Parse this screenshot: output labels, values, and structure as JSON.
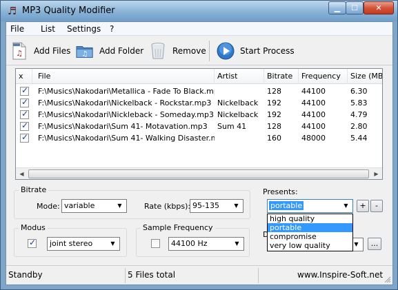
{
  "window": {
    "title": "MP3 Quality Modifier"
  },
  "menu": [
    "File",
    "List",
    "Settings",
    "?"
  ],
  "toolbar": {
    "add_files": "Add Files",
    "add_folder": "Add Folder",
    "remove": "Remove",
    "start_process": "Start Process"
  },
  "table": {
    "columns": [
      "x",
      "File",
      "Artist",
      "Bitrate",
      "Frequency",
      "Size (MB)"
    ],
    "rows": [
      {
        "checked": true,
        "file": "F:\\Musics\\Nakodari\\Metallica - Fade To Black.mp3",
        "artist": "",
        "bitrate": "128",
        "frequency": "44100",
        "size": "6.30"
      },
      {
        "checked": true,
        "file": "F:\\Musics\\Nakodari\\Nickelback - Rockstar.mp3",
        "artist": "Nickelback",
        "bitrate": "192",
        "frequency": "44100",
        "size": "5.83"
      },
      {
        "checked": true,
        "file": "F:\\Musics\\Nakodari\\Nickleback - Someday.mp3",
        "artist": "Nickelback",
        "bitrate": "192",
        "frequency": "44100",
        "size": "4.79"
      },
      {
        "checked": true,
        "file": "F:\\Musics\\Nakodari\\Sum 41- Motavation.mp3",
        "artist": "Sum 41",
        "bitrate": "128",
        "frequency": "44100",
        "size": "2.80"
      },
      {
        "checked": true,
        "file": "F:\\Musics\\Nakodari\\Sum 41- Walking Disaster.mp3",
        "artist": "",
        "bitrate": "160",
        "frequency": "48000",
        "size": "5.44"
      }
    ]
  },
  "bitrate": {
    "group_label": "Bitrate",
    "mode_label": "Mode:",
    "mode_value": "variable",
    "rate_label": "Rate (kbps):",
    "rate_value": "95-135"
  },
  "modus": {
    "group_label": "Modus",
    "checked": true,
    "value": "joint stereo"
  },
  "sample_frequency": {
    "group_label": "Sample Frequency",
    "checked": false,
    "value": "44100 Hz"
  },
  "presents": {
    "label": "Presents:",
    "selected": "portable",
    "add": "+",
    "remove": "-",
    "options": [
      "high quality",
      "portable",
      "compromise",
      "very low quality"
    ],
    "highlighted": "portable",
    "partial_label": "D",
    "browse": "..."
  },
  "status": {
    "state": "Standby",
    "count": "5 Files total",
    "website": "www.Inspire-Soft.net"
  }
}
